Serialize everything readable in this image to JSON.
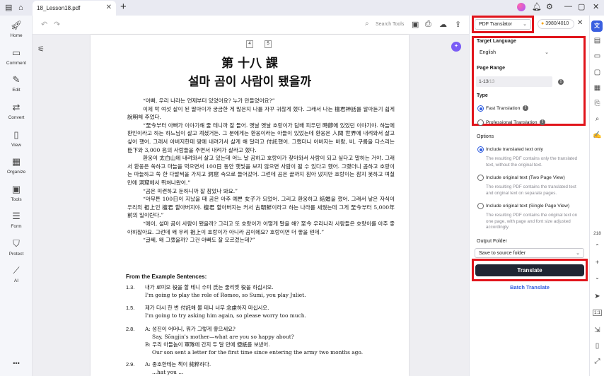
{
  "titlebar": {
    "tab_name": "18_Lesson18.pdf",
    "tab_close": "✕",
    "new_tab": "+"
  },
  "leftbar": {
    "items": [
      {
        "label": "Home",
        "icon": "rocket-icon"
      },
      {
        "label": "Comment",
        "icon": "comment-icon"
      },
      {
        "label": "Edit",
        "icon": "edit-icon"
      },
      {
        "label": "Convert",
        "icon": "convert-icon"
      },
      {
        "label": "View",
        "icon": "view-icon"
      },
      {
        "label": "Organize",
        "icon": "organize-icon"
      },
      {
        "label": "Tools",
        "icon": "tools-icon"
      },
      {
        "label": "Form",
        "icon": "form-icon"
      },
      {
        "label": "Protect",
        "icon": "shield-icon"
      },
      {
        "label": "AI",
        "icon": "ai-icon"
      }
    ],
    "more": "•••"
  },
  "toolbar": {
    "search_label": "Search Tools"
  },
  "document": {
    "page_left_num": "4",
    "page_right_num": "5",
    "lesson_title": "第 十八 課",
    "story_title": "설마 곰이 사람이 됐을까",
    "paragraphs": [
      "“아빠, 우리 나라는 언제부터 있었어요? 누가 만들었어요?”",
      "이제 막 여섯 살이 된 딸아이가 궁금한 게 많은지 나를 자꾸 귀찮게 했다. 그래서 나는 檀君神話를 알아듣기 쉽게 說明해 주었다.",
      "“至今부터 아빠가 이야기해 줄 테니까 잘 들어. 옛날 옛날 호랑이가 담배 피우던 時節에 있었던 이야기야. 하늘에 환인이라고 하는 하느님이 살고 계셨거든. 그 분에게는 환웅이라는 아들이 있었는데 환웅은 人間 世界에 내려와서 살고 싶어 했어. 그래서 아버지한테 땅에 내려가서 살게 해 달라고 付託했어. 그랬더니 아버지는 바람, 비, 구름을 다스리는 臣下와 3,000 名의 사람들을 주면서 내려가 살라고 했다.",
      "환웅이 太白山에 내려와서 살고 있는데 어느 날 곰하고 호랑이가 찾아와서 사람이 되고 싶다고 말하는 거야. 그래서 환웅은 쑥하고 마늘을 먹으면서 100日 동안 햇빛을 보지 않으면 사람이 될 수 있다고 했어. 그랬더니 곰하고 호랑이는 마늘하고 쑥 한 다발씩을 가지고 洞窟 속으로 들어갔어. 그런데 곰은 끝까지 참아 냈지만 호랑이는 참지 못하고 며칠 만에 洞窟에서 뛰쳐나왔어.”",
      "“곰은 미련하고 둔하니까 잘 참았나 봐요.”",
      "“아무튼 100日이 지났을 때 곰은 아주 예쁜 女子가 되었어. 그리고 환웅하고 結婚을 했어. 그래서 낳은 자식이 우리의 祖上인 檀君 할아버지야. 檀君 할아버지는 커서 古朝鮮이라고 하는 나라를 세웠는데 그게 至今부터 5,000年 前의 일이란다.”",
      "“에이, 설마 곰이 사람이 됐을까? 그리고 또 호랑이가 어떻게 말을 해? 至今 우리나라 사람들은 호랑이를 아주 좋아하잖아요. 그런데 왜 우리 祖上이 호랑이가 아니라 곰이에요? 호랑이면 더 좋을 텐데.”",
      "“글쎄, 왜 그랬을까? 그건 아빠도 잘 모르겠는데?”"
    ],
    "examples_heading": "From the Example Sentences:",
    "examples": [
      {
        "num": "1.3.",
        "lines": [
          "내가 로미오 役을 할 테니 수미 氏는 줄리엣 役을 하십시오.",
          "I'm going to play the role of Romeo, so Sumi, you play Juliet."
        ]
      },
      {
        "num": "1.5.",
        "lines": [
          "제가 다시 한 번 付託해 볼 테니 너무 念慮하지 마십시오.",
          "I'm going to try asking him again, so please worry too much."
        ]
      },
      {
        "num": "2.8.",
        "lines": [
          "A: 성진이 어머니, 뭐가 그렇게 좋으세요?",
          "Say, Sŏngjin's mother—what are you so happy about?",
          "B: 우리 아들놈이 軍隊에 간지 두 달 만에 便紙를 보냈어.",
          "Our son sent a letter for the first time since entering the army two months ago."
        ]
      },
      {
        "num": "2.9.",
        "lines": [
          "A: 종호한테는 책이 純粹하다.",
          "...hat you ..."
        ]
      }
    ]
  },
  "panel": {
    "translator_select": "PDF Translator",
    "credits": "3980/4010",
    "target_language_label": "Target Language",
    "target_language_value": "English",
    "page_range_label": "Page Range",
    "page_range_value": "1-13",
    "page_range_total": "/13",
    "type_label": "Type",
    "type_fast": "Fast Translation",
    "type_professional": "Professional Translation",
    "options_label": "Options",
    "opt1_label": "Include translated text only",
    "opt1_desc": "The resulting PDF contains only the translated text, without the original text.",
    "opt2_label": "Include original text (Two Page View)",
    "opt2_desc": "The resulting PDF contains the translated text and original text on separate pages.",
    "opt3_label": "Include original text (Single Page View)",
    "opt3_desc": "The resulting PDF contains the original text on one page, with page and font size adjusted accordingly.",
    "output_label": "Output Folder",
    "output_value": "Save to source folder",
    "translate_button": "Translate",
    "batch_button": "Batch Translate"
  },
  "rightrail": {
    "page_number": "218",
    "zoom_number": "1:1"
  },
  "colors": {
    "highlight_red": "#e1141b",
    "accent_blue": "#2f5de0",
    "button_dark": "#1f2533"
  }
}
